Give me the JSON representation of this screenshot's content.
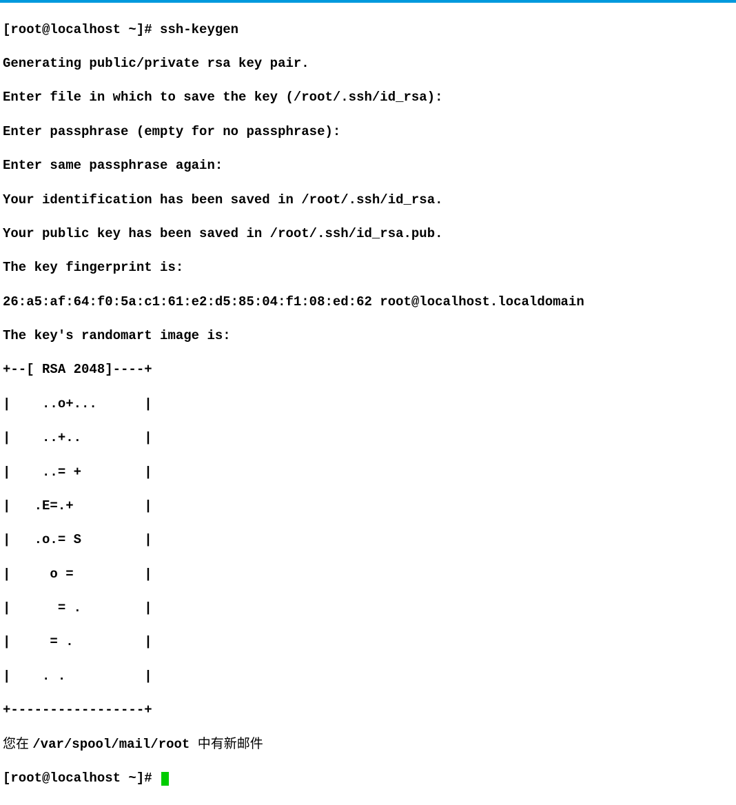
{
  "prompts": {
    "prompt1_prefix": "[root@localhost ~]# ",
    "prompt2_prefix": "[root@localhost ~]# "
  },
  "commands": {
    "cmd1": "ssh-keygen"
  },
  "output": {
    "line1": "Generating public/private rsa key pair.",
    "line2": "Enter file in which to save the key (/root/.ssh/id_rsa):",
    "line3": "Enter passphrase (empty for no passphrase):",
    "line4": "Enter same passphrase again:",
    "line5": "Your identification has been saved in /root/.ssh/id_rsa.",
    "line6": "Your public key has been saved in /root/.ssh/id_rsa.pub.",
    "line7": "The key fingerprint is:",
    "line8": "26:a5:af:64:f0:5a:c1:61:e2:d5:85:04:f1:08:ed:62 root@localhost.localdomain",
    "line9": "The key's randomart image is:",
    "art1": "+--[ RSA 2048]----+",
    "art2": "|    ..o+...      |",
    "art3": "|    ..+..        |",
    "art4": "|    ..= +        |",
    "art5": "|   .E=.+         |",
    "art6": "|   .o.= S        |",
    "art7": "|     o =         |",
    "art8": "|      = .        |",
    "art9": "|     = .         |",
    "art10": "|    . .          |",
    "art11": "+-----------------+"
  },
  "mail": {
    "prefix_cjk": "您在 ",
    "path": "/var/spool/mail/root ",
    "suffix_cjk": "中有新邮件"
  }
}
